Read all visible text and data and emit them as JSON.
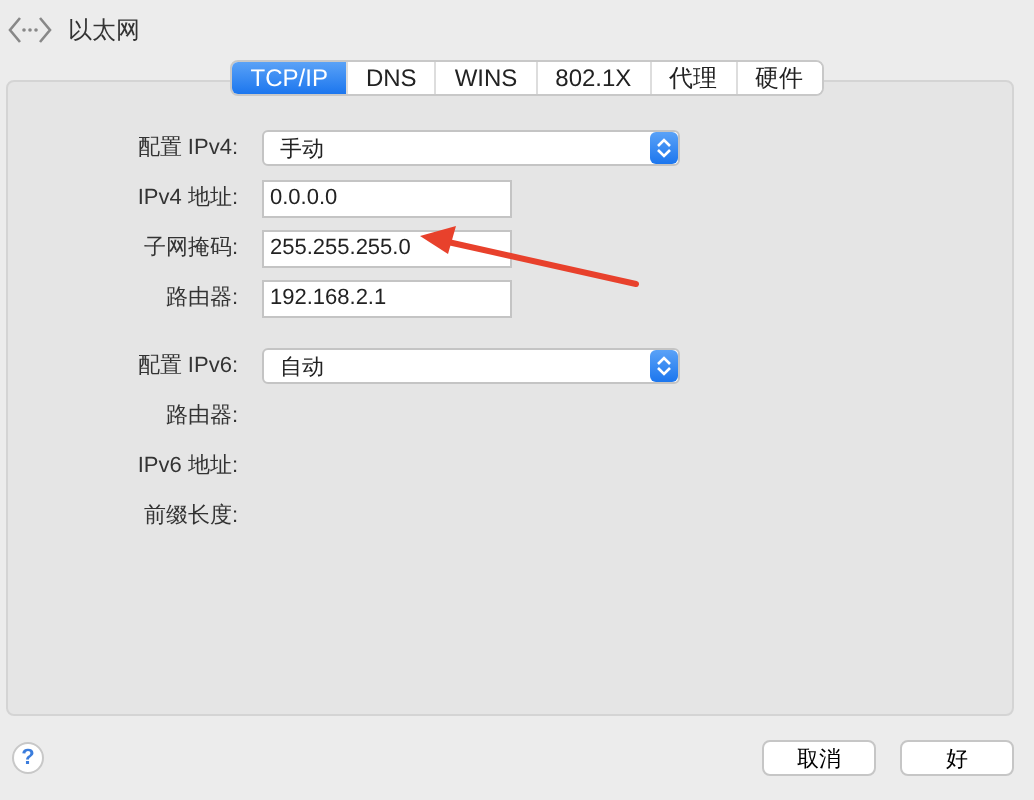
{
  "window": {
    "title": "以太网"
  },
  "tabs": [
    {
      "label": "TCP/IP",
      "selected": true
    },
    {
      "label": "DNS",
      "selected": false
    },
    {
      "label": "WINS",
      "selected": false
    },
    {
      "label": "802.1X",
      "selected": false
    },
    {
      "label": "代理",
      "selected": false
    },
    {
      "label": "硬件",
      "selected": false
    }
  ],
  "ipv4": [
    {
      "kind": "select",
      "label": "配置 IPv4:",
      "value": "手动"
    },
    {
      "kind": "text",
      "label": "IPv4 地址:",
      "value": "0.0.0.0"
    },
    {
      "kind": "text",
      "label": "子网掩码:",
      "value": "255.255.255.0"
    },
    {
      "kind": "text",
      "label": "路由器:",
      "value": "192.168.2.1"
    }
  ],
  "ipv6": [
    {
      "kind": "select",
      "label": "配置 IPv6:",
      "value": "自动"
    },
    {
      "kind": "empty",
      "label": "路由器:"
    },
    {
      "kind": "empty",
      "label": "IPv6 地址:"
    },
    {
      "kind": "empty",
      "label": "前缀长度:"
    }
  ],
  "help_button": {
    "label": "?"
  },
  "buttons": [
    "取消",
    "好"
  ]
}
